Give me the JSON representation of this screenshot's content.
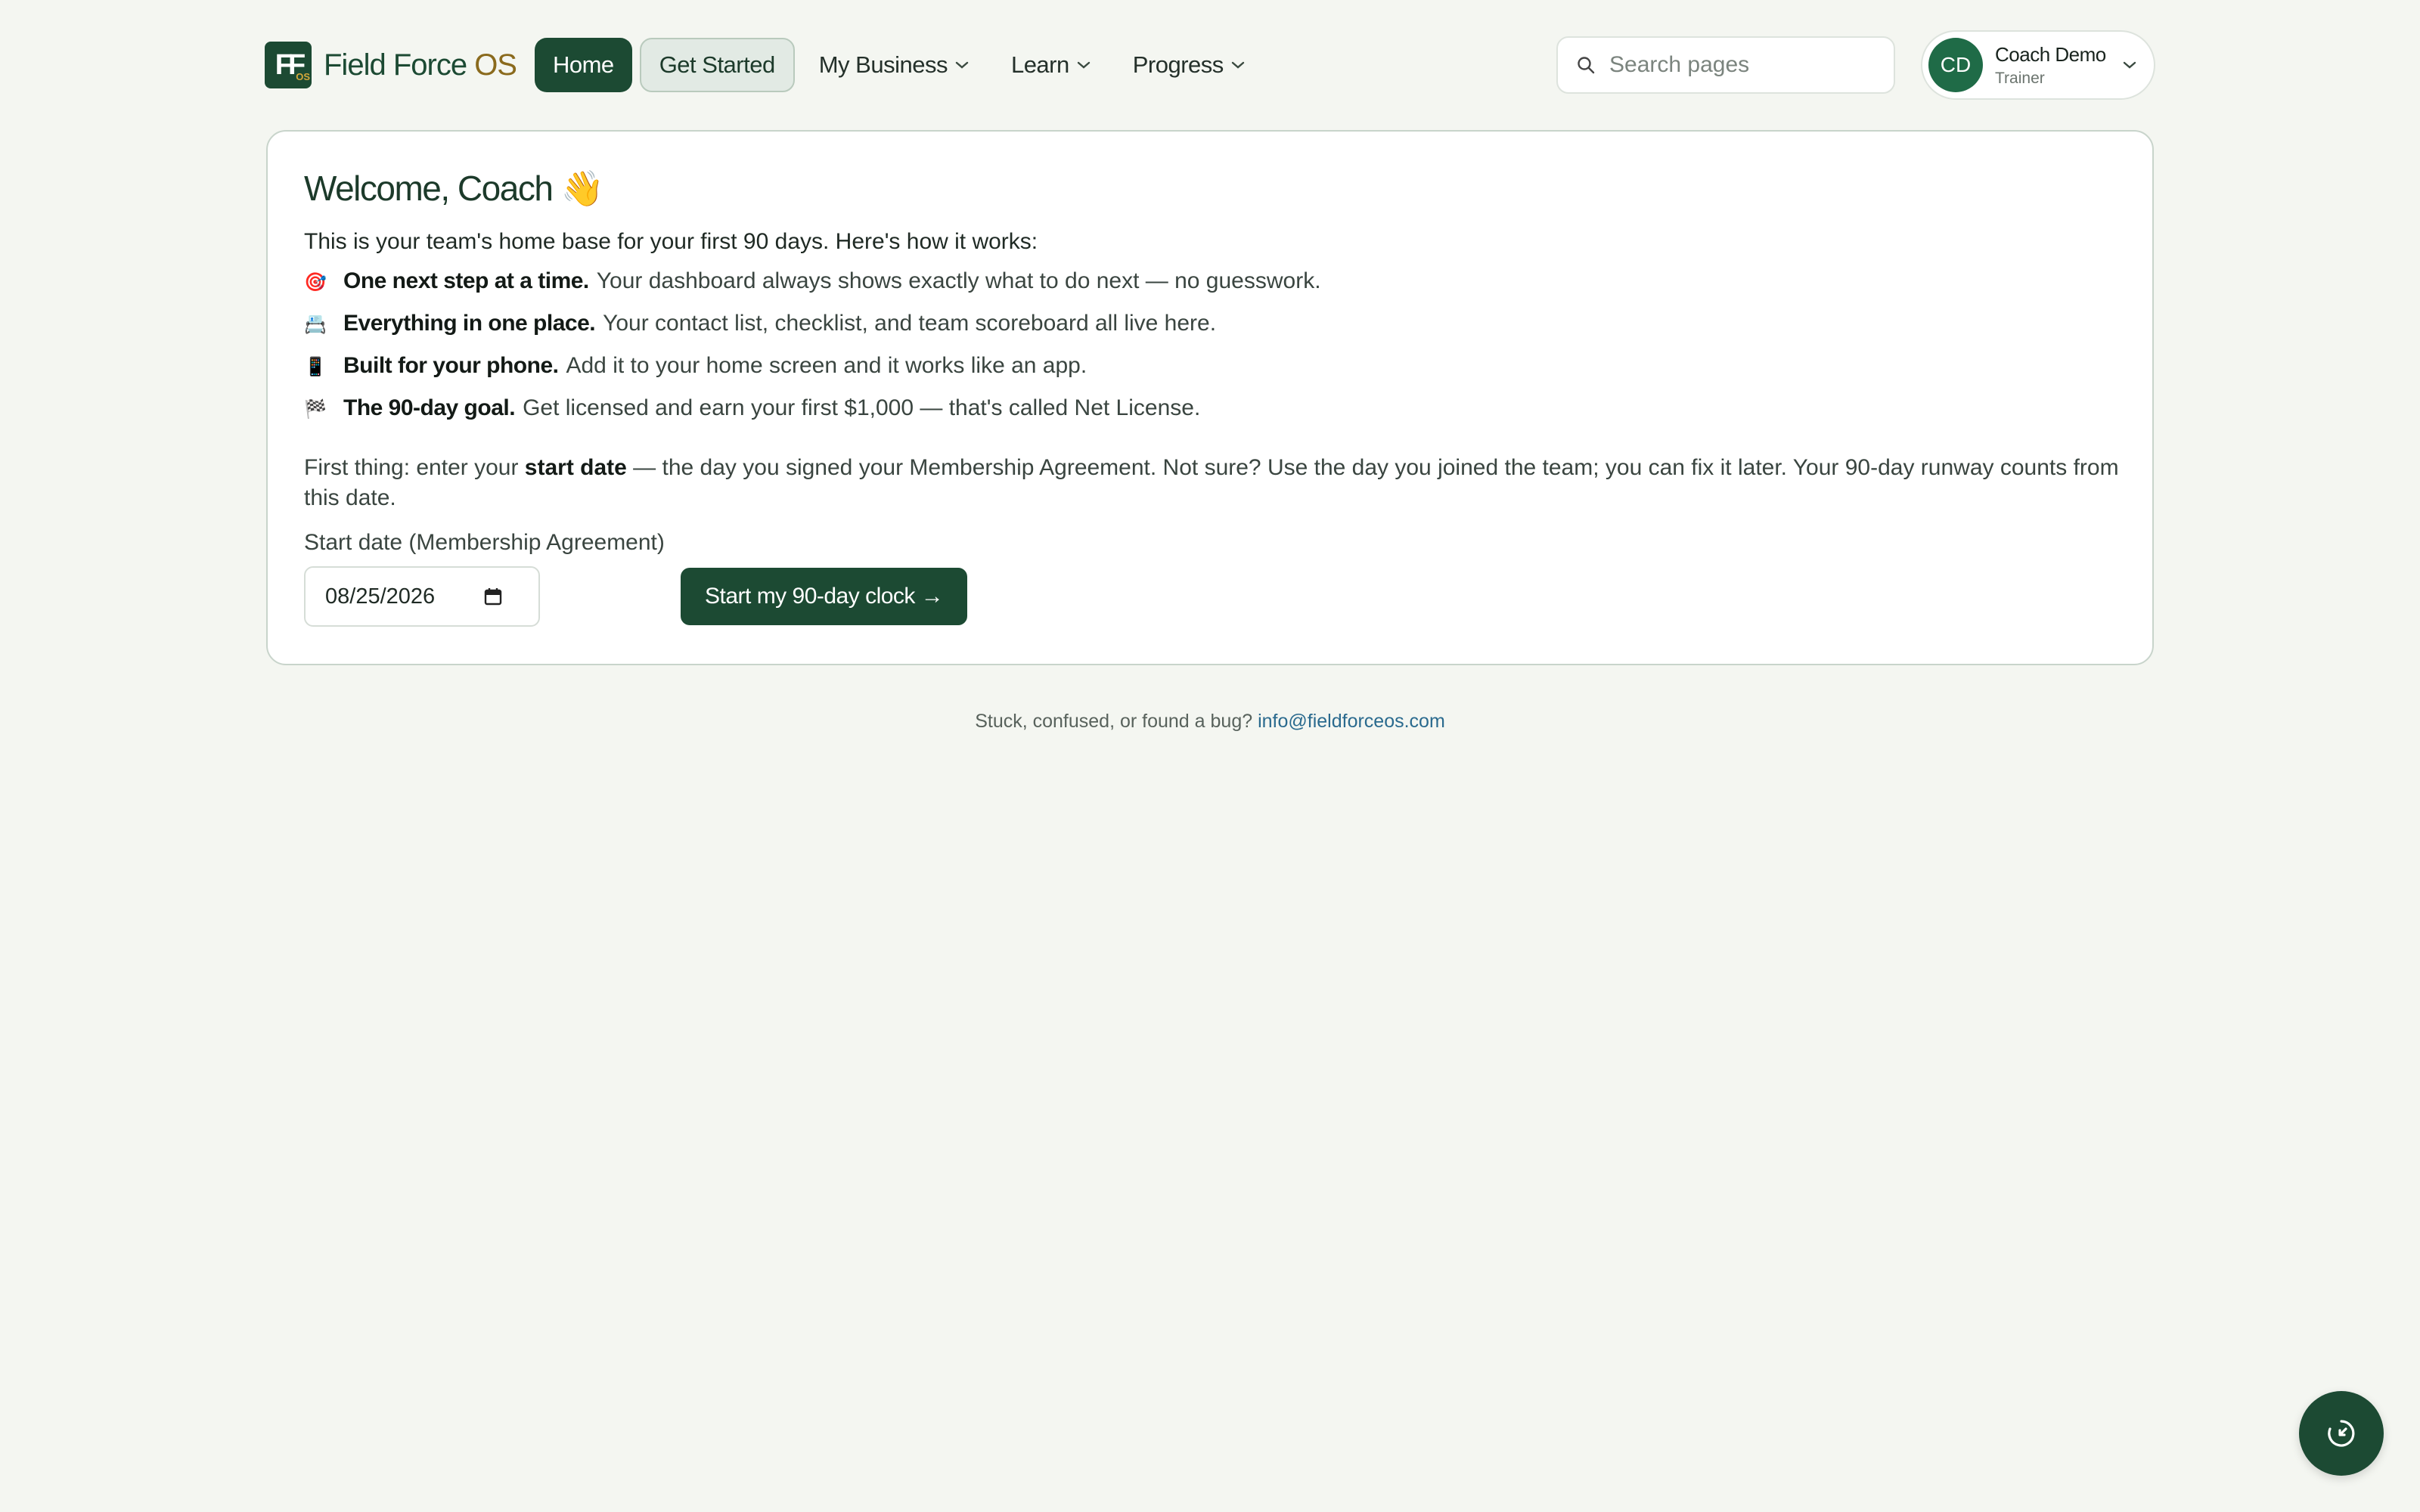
{
  "brand": {
    "logo_text": "FF",
    "logo_sub": "OS",
    "name": "Field Force",
    "name_accent": "OS",
    "color": "#1c4a33",
    "accent_color": "#8a6a1d"
  },
  "nav": {
    "home": "Home",
    "get_started": "Get Started",
    "my_business": "My Business",
    "learn": "Learn",
    "progress": "Progress"
  },
  "search": {
    "placeholder": "Search pages",
    "icon": "search-icon"
  },
  "user": {
    "initials": "CD",
    "name": "Coach Demo",
    "role": "Trainer"
  },
  "card": {
    "title": "Welcome, Coach",
    "title_emoji": "👋",
    "intro": "This is your team's home base for your first 90 days. Here's how it works:",
    "bullets": [
      {
        "icon": "🎯",
        "bold": "One next step at a time.",
        "text": "Your dashboard always shows exactly what to do next — no guesswork."
      },
      {
        "icon": "📇",
        "bold": "Everything in one place.",
        "text": "Your contact list, checklist, and team scoreboard all live here."
      },
      {
        "icon": "📱",
        "bold": "Built for your phone.",
        "text": "Add it to your home screen and it works like an app."
      },
      {
        "icon": "🏁",
        "bold": "The 90-day goal.",
        "text": "Get licensed and earn your first $1,000 — that's called Net License."
      }
    ],
    "first_thing_pre": "First thing: enter your ",
    "first_thing_bold": "start date",
    "first_thing_post": " — the day you signed your Membership Agreement. Not sure? Use the day you joined the team; you can fix it later. Your 90-day runway counts from this date.",
    "date_label": "Start date (Membership Agreement)",
    "date_value": "08/25/2026",
    "start_button": "Start my 90-day clock →"
  },
  "footer": {
    "text": "Stuck, confused, or found a bug? ",
    "email": "info@fieldforceos.com"
  }
}
